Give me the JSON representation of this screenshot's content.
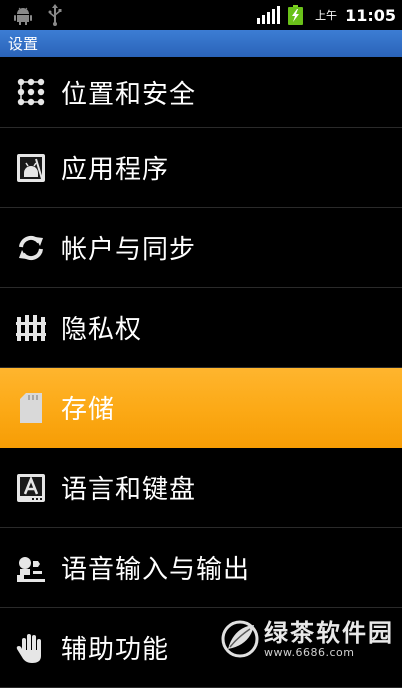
{
  "status_bar": {
    "left_icons": [
      "android-debug-icon",
      "usb-icon"
    ],
    "right_icons": [
      "signal-icon",
      "battery-charging-icon"
    ],
    "time_period": "上午",
    "time": "11:05"
  },
  "title_bar": {
    "title": "设置"
  },
  "settings": {
    "items": [
      {
        "label": "位置和安全",
        "icon": "location-security-icon"
      },
      {
        "label": "应用程序",
        "icon": "applications-icon"
      },
      {
        "label": "帐户与同步",
        "icon": "sync-icon"
      },
      {
        "label": "隐私权",
        "icon": "privacy-icon"
      },
      {
        "label": "存储",
        "icon": "sd-card-icon",
        "selected": true
      },
      {
        "label": "语言和键盘",
        "icon": "language-keyboard-icon"
      },
      {
        "label": "语音输入与输出",
        "icon": "voice-io-icon"
      },
      {
        "label": "辅助功能",
        "icon": "accessibility-icon"
      }
    ]
  },
  "watermark": {
    "name": "绿茶软件园",
    "url": "www.6686.com"
  },
  "colors": {
    "title_bar": "#2f6cc2",
    "selected_item": "#fcaa17",
    "background": "#000000"
  }
}
